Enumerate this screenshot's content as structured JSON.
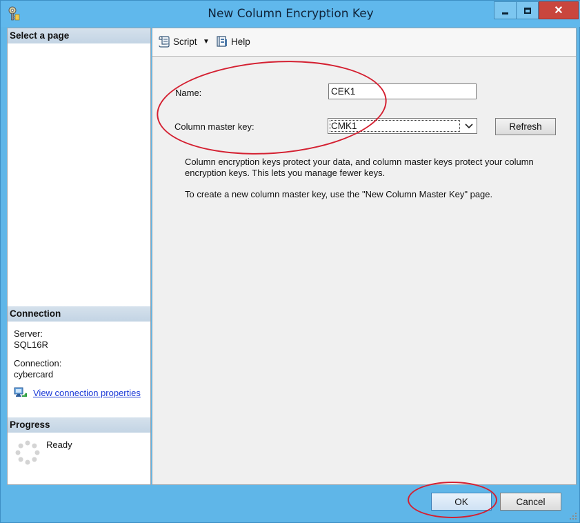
{
  "window": {
    "title": "New Column Encryption Key",
    "close_glyph": "✕",
    "icons": [
      "key-app-icon",
      "minimize-icon",
      "maximize-icon",
      "close-icon"
    ]
  },
  "left_pane": {
    "select_page_header": "Select a page",
    "connection_header": "Connection",
    "server_label": "Server:",
    "server_value": "SQL16R",
    "connection_label": "Connection:",
    "connection_value": "cybercard",
    "view_connection_link": "View connection properties",
    "progress_header": "Progress",
    "progress_status": "Ready"
  },
  "toolbar": {
    "script_label": "Script",
    "help_label": "Help",
    "dropdown_glyph": "▼"
  },
  "form": {
    "name_label": "Name:",
    "name_value": "CEK1",
    "cmk_label": "Column master key:",
    "cmk_value": "CMK1",
    "refresh_label": "Refresh",
    "description_1": "Column encryption keys protect your data, and column master keys protect your column encryption keys. This lets you manage fewer keys.",
    "description_2": "To create a new column master key, use the \"New Column Master Key\" page."
  },
  "footer": {
    "ok_label": "OK",
    "cancel_label": "Cancel"
  },
  "colors": {
    "titlebar": "#60b8ec",
    "close_button": "#c9463d",
    "annotation": "#d42031",
    "link": "#1a38d6"
  }
}
